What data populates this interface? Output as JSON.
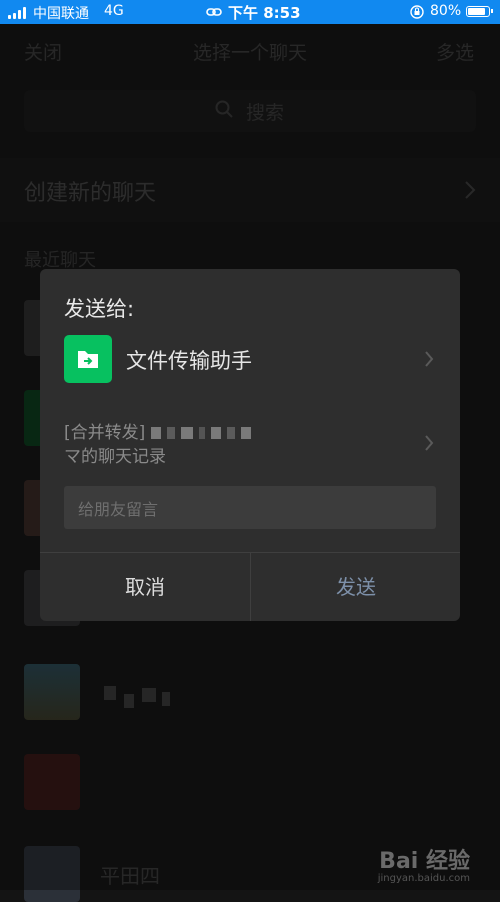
{
  "status_bar": {
    "carrier": "中国联通",
    "network": "4G",
    "time": "下午 8:53",
    "battery": "80%",
    "battery_level": 0.8
  },
  "background": {
    "nav": {
      "close": "关闭",
      "title": "选择一个聊天",
      "multi_select": "多选"
    },
    "search": {
      "placeholder": "搜索"
    },
    "create_chat": "创建新的聊天",
    "recent_label": "最近聊天",
    "bottom_snippet": "平田四"
  },
  "dialog": {
    "title": "发送给:",
    "target_name": "文件传输助手",
    "message_line1": "[合并转发]",
    "message_line2": "マ的聊天记录",
    "note_placeholder": "给朋友留言",
    "cancel": "取消",
    "send": "发送"
  },
  "watermark": {
    "brand": "Bai 经验",
    "url": "jingyan.baidu.com"
  },
  "colors": {
    "status_bar": "#1189f0",
    "file_helper": "#07c160",
    "send": "#7d90a9"
  }
}
